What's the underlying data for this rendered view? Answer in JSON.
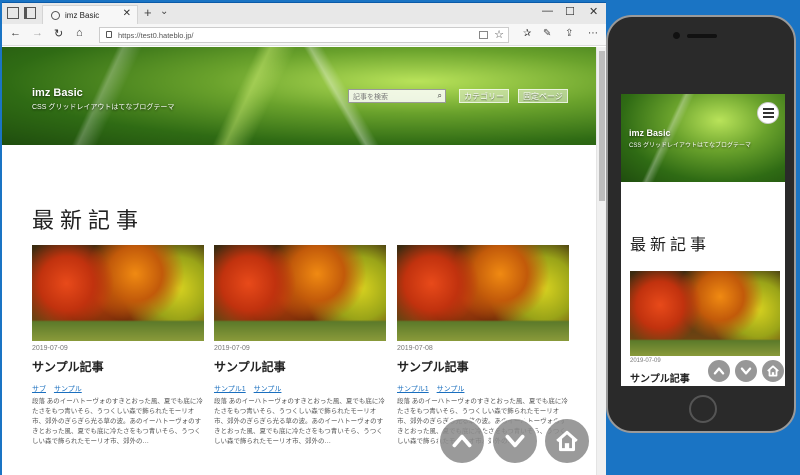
{
  "browser": {
    "tab_title": "imz Basic",
    "new_tab_glyph": "+",
    "url": "https://test0.hateblo.jp/",
    "window_controls": [
      "—",
      "☐",
      "✕"
    ]
  },
  "site": {
    "title": "imz Basic",
    "subtitle": "CSS グリッドレイアウトはてなブログテーマ",
    "search_placeholder": "記事を検索",
    "nav": [
      "カテゴリー",
      "固定ページ"
    ],
    "section_heading": "最新記事"
  },
  "articles": [
    {
      "date": "2019-07-09",
      "title": "サンプル記事",
      "tags": [
        "サブ",
        "サンプル"
      ],
      "excerpt": "段落 あのイーハトーヴォのすきとおった風、夏でも底に冷たさをもつ青いそら、うつくしい森で飾られたモーリオ市、郊外のぎらぎら光る草の波。あのイーハトーヴォのすきとおった風、夏でも底に冷たさをもつ青いそら、うつくしい森で飾られたモーリオ市、郊外の…"
    },
    {
      "date": "2019-07-09",
      "title": "サンプル記事",
      "tags": [
        "サンプル1",
        "サンプル"
      ],
      "excerpt": "段落 あのイーハトーヴォのすきとおった風、夏でも底に冷たさをもつ青いそら、うつくしい森で飾られたモーリオ市、郊外のぎらぎら光る草の波。あのイーハトーヴォのすきとおった風、夏でも底に冷たさをもつ青いそら、うつくしい森で飾られたモーリオ市、郊外の…"
    },
    {
      "date": "2019-07-08",
      "title": "サンプル記事",
      "tags": [
        "サンプル1",
        "サンプル"
      ],
      "excerpt": "段落 あのイーハトーヴォのすきとおった風、夏でも底に冷たさをもつ青いそら、うつくしい森で飾られたモーリオ市、郊外のぎらぎら光る草の波。あのイーハトーヴォのすきとおった風、夏でも底に冷たさをもつ青いそら、うつくしい森で飾られたモーリオ市、郊外の…"
    }
  ],
  "phone": {
    "title": "imz Basic",
    "subtitle": "CSS グリッドレイアウトはてなブログテーマ",
    "section_heading": "最新記事",
    "article_date": "2019-07-09",
    "article_title": "サンプル記事"
  },
  "icons": {
    "scroll_up": "chevron-up-icon",
    "scroll_down": "chevron-down-icon",
    "home": "home-icon",
    "menu": "hamburger-menu-icon"
  }
}
